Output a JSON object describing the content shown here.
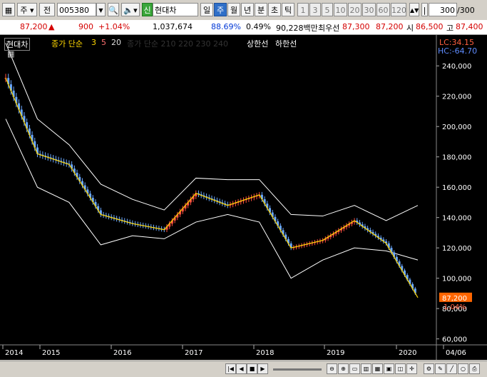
{
  "toolbar": {
    "market_prefix": "주",
    "type_label": "전",
    "code": "005380",
    "badge": "신",
    "name": "현대차",
    "periods": [
      "일",
      "주",
      "월",
      "년",
      "분",
      "초",
      "틱"
    ],
    "selected_period": "주",
    "intervals": [
      "1",
      "3",
      "5",
      "10",
      "20",
      "30",
      "60",
      "120"
    ],
    "count": "300",
    "count_total": "/300"
  },
  "quote": {
    "price": "87,200",
    "change_arrow": "▲",
    "change": "900",
    "change_pct": "+1.04%",
    "volume": "1,037,674",
    "ratio": "88.69%",
    "turnover": "0.49%",
    "amount": "90,228백만",
    "prefer_label": "최우선",
    "ask": "87,300",
    "bid": "87,200",
    "open_label": "시",
    "open": "86,500",
    "high_label": "고",
    "high": "87,400"
  },
  "legend": {
    "ticker": "현대차",
    "ma_label": "종가 단순",
    "ma_periods": [
      "3",
      "5",
      "20"
    ],
    "ma_dim": "종가 단순 210 220 230 240",
    "upper": "상한선",
    "lower": "하한선"
  },
  "chart_data": {
    "type": "line",
    "title": "현대차",
    "x": [
      "2014",
      "2014.5",
      "2015",
      "2015.5",
      "2016",
      "2016.5",
      "2017",
      "2017.5",
      "2018",
      "2018.5",
      "2019",
      "2019.5",
      "2020",
      "2020.2"
    ],
    "series": [
      {
        "name": "종가",
        "values": [
          232000,
          182000,
          175000,
          142000,
          136000,
          132000,
          156000,
          148000,
          155000,
          120000,
          125000,
          138000,
          123000,
          87200
        ]
      }
    ],
    "upper_band": [
      255000,
      205000,
      188000,
      162000,
      152000,
      145000,
      166000,
      165000,
      165000,
      142000,
      141000,
      148000,
      138000,
      148000
    ],
    "lower_band": [
      205000,
      160000,
      150000,
      122000,
      128000,
      126000,
      137000,
      142000,
      137000,
      100000,
      112000,
      120000,
      118000,
      112000
    ],
    "y_ticks": [
      "240,000",
      "220,000",
      "200,000",
      "180,000",
      "160,000",
      "140,000",
      "120,000",
      "100,000",
      "80,000",
      "60,000"
    ],
    "x_ticks": [
      "2014",
      "2015",
      "2016",
      "2017",
      "2018",
      "2019",
      "2020",
      "04/06"
    ],
    "ylim": [
      57000,
      250000
    ],
    "last_price": "87,200",
    "last_pct": "1.04%",
    "lc": "LC:34.15",
    "hc": "HC:-64.70"
  },
  "colors": {
    "background": "#000000",
    "up": "#ff5040",
    "down": "#6aa8ff",
    "ma3": "#ffd700",
    "band": "#ffffff",
    "price_tag": "#ff6600"
  }
}
